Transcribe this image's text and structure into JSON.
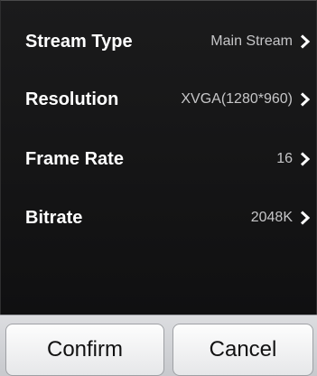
{
  "settings": {
    "rows": [
      {
        "label": "Stream Type",
        "value": "Main Stream"
      },
      {
        "label": "Resolution",
        "value": "XVGA(1280*960)"
      },
      {
        "label": "Frame Rate",
        "value": "16"
      },
      {
        "label": "Bitrate",
        "value": "2048K"
      }
    ],
    "row_chevron_icon": "chevron-right-icon"
  },
  "footer": {
    "confirm_label": "Confirm",
    "cancel_label": "Cancel"
  },
  "colors": {
    "panel_background": "#141415",
    "label_text": "#ffffff",
    "value_text": "#c6c6c8",
    "footer_background": "#d2d4d7"
  }
}
